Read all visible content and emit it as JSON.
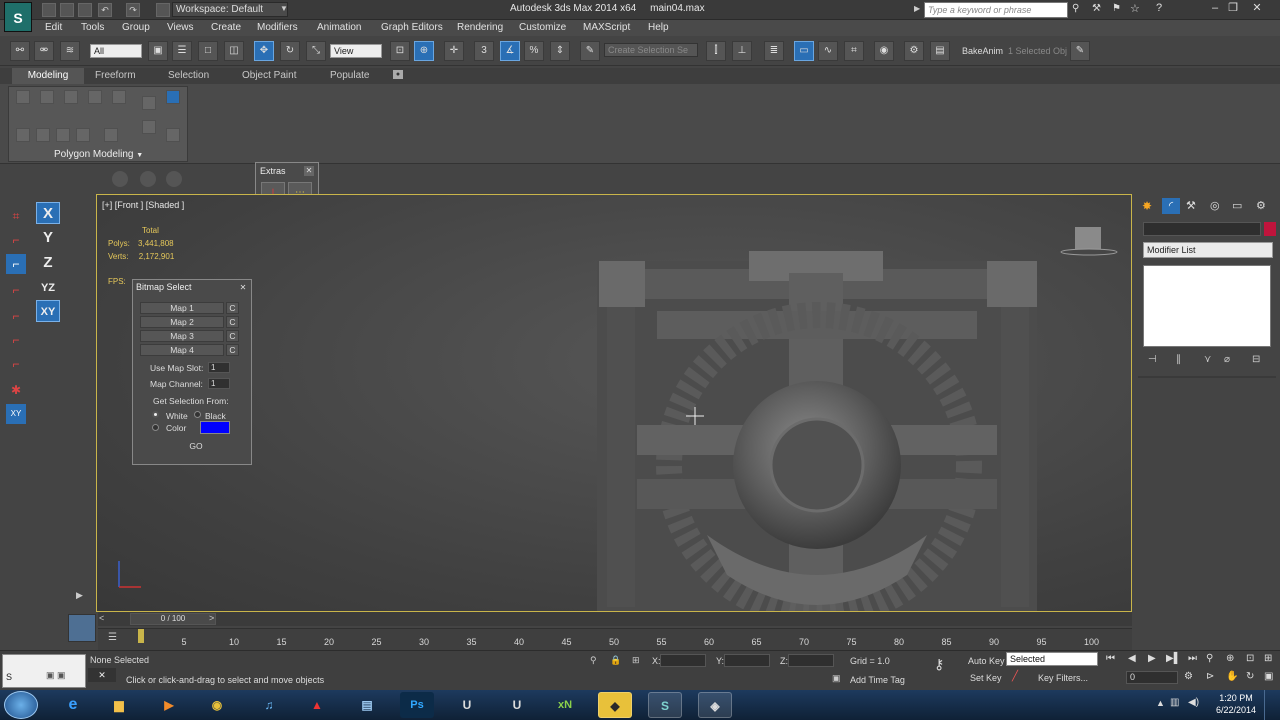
{
  "window": {
    "workspace": "Workspace: Default",
    "app_title": "Autodesk 3ds Max  2014 x64",
    "file_name": "main04.max",
    "search_placeholder": "Type a keyword or phrase"
  },
  "menu": [
    "Edit",
    "Tools",
    "Group",
    "Views",
    "Create",
    "Modifiers",
    "Animation",
    "Graph Editors",
    "Rendering",
    "Customize",
    "MAXScript",
    "Help"
  ],
  "toolbar": {
    "filter": "All",
    "ref_coord": "View",
    "named_selection_placeholder": "Create Selection Se",
    "bake_label": "BakeAnim",
    "selected_label": "1 Selected Obj"
  },
  "ribbon": {
    "tabs": [
      "Modeling",
      "Freeform",
      "Selection",
      "Object Paint",
      "Populate"
    ],
    "group_label": "Polygon Modeling"
  },
  "viewport": {
    "label": "[+] [Front ] [Shaded ]",
    "stats_title": "Total",
    "polys_label": "Polys:",
    "polys_value": "3,441,808",
    "verts_label": "Verts:",
    "verts_value": "2,172,901",
    "fps_label": "FPS:"
  },
  "extras": {
    "title": "Extras"
  },
  "bitmap_select": {
    "title": "Bitmap Select",
    "maps": [
      "Map 1",
      "Map 2",
      "Map 3",
      "Map 4"
    ],
    "c_label": "C",
    "use_map_slot_label": "Use Map Slot:",
    "use_map_slot_value": "1",
    "map_channel_label": "Map Channel:",
    "map_channel_value": "1",
    "get_selection_label": "Get Selection From:",
    "white_label": "White",
    "black_label": "Black",
    "color_label": "Color",
    "color_value": "#0000ff",
    "go_label": "GO"
  },
  "command_panel": {
    "modifier_list": "Modifier List",
    "object_color": "#c0143c"
  },
  "left_toolbar": {
    "axes": [
      "X",
      "Y",
      "Z",
      "YZ",
      "XY"
    ]
  },
  "timeline": {
    "frame_display": "0 / 100",
    "ticks": [
      "5",
      "10",
      "15",
      "20",
      "25",
      "30",
      "35",
      "40",
      "45",
      "50",
      "55",
      "60",
      "65",
      "70",
      "75",
      "80",
      "85",
      "90",
      "95",
      "100"
    ]
  },
  "status": {
    "selection": "None Selected",
    "prompt": "Click or click-and-drag to select and move objects",
    "x_label": "X:",
    "y_label": "Y:",
    "z_label": "Z:",
    "grid": "Grid = 1.0",
    "add_time_tag": "Add Time Tag",
    "auto_key": "Auto Key",
    "selected_option": "Selected",
    "set_key": "Set Key",
    "key_filters": "Key Filters...",
    "frame_value": "0"
  },
  "taskbar": {
    "time": "1:20 PM",
    "date": "6/22/2014",
    "apps": [
      "IE",
      "Folder",
      "Media",
      "Chrome",
      "iTunes",
      "Flash",
      "Window",
      "Ps",
      "UDK",
      "Unreal",
      "xN",
      "Sketch",
      "3ds Max",
      "Tool"
    ]
  }
}
